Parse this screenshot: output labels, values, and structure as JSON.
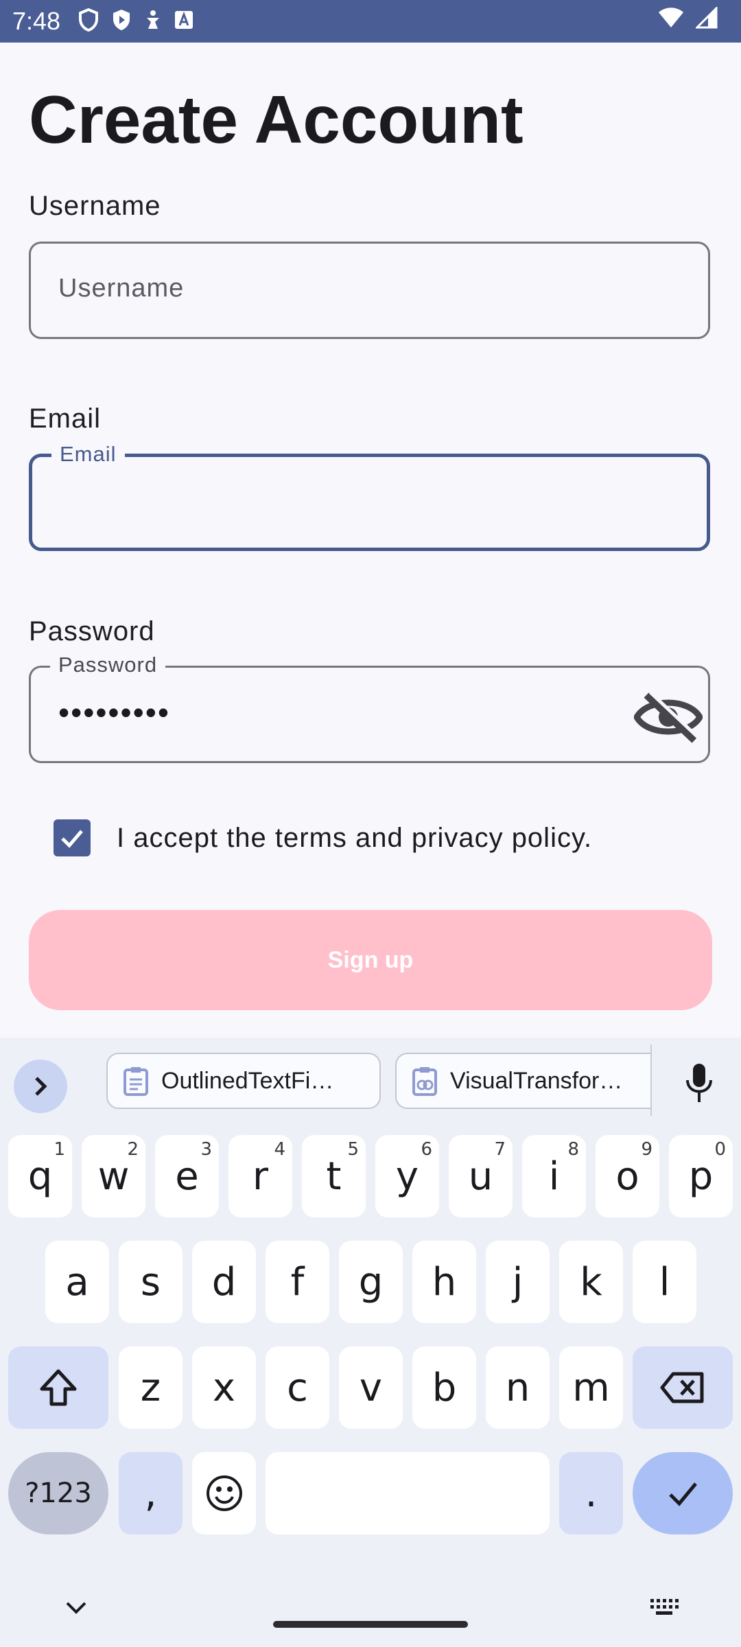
{
  "status_bar": {
    "time": "7:48"
  },
  "page": {
    "title": "Create Account"
  },
  "form": {
    "username": {
      "label": "Username",
      "placeholder": "Username"
    },
    "email": {
      "label": "Email",
      "floating_label": "Email",
      "value": ""
    },
    "password": {
      "label": "Password",
      "floating_label": "Password",
      "masked_value": "•••••••••",
      "toggle_icon": "visibility-off-icon"
    },
    "terms": {
      "checked": true,
      "text": "I accept the terms and privacy policy."
    },
    "signup_button": "Sign up"
  },
  "colors": {
    "primary": "#4a5d94",
    "signup_disabled": "#ffc0cc",
    "focused_border": "#465a8e"
  },
  "keyboard": {
    "suggestions": [
      "OutlinedTextFi…",
      "VisualTransfor…"
    ],
    "row1": [
      {
        "k": "q",
        "h": "1"
      },
      {
        "k": "w",
        "h": "2"
      },
      {
        "k": "e",
        "h": "3"
      },
      {
        "k": "r",
        "h": "4"
      },
      {
        "k": "t",
        "h": "5"
      },
      {
        "k": "y",
        "h": "6"
      },
      {
        "k": "u",
        "h": "7"
      },
      {
        "k": "i",
        "h": "8"
      },
      {
        "k": "o",
        "h": "9"
      },
      {
        "k": "p",
        "h": "0"
      }
    ],
    "row2": [
      "a",
      "s",
      "d",
      "f",
      "g",
      "h",
      "j",
      "k",
      "l"
    ],
    "row3": [
      "z",
      "x",
      "c",
      "v",
      "b",
      "n",
      "m"
    ],
    "symbols_key": "?123",
    "comma_key": ",",
    "period_key": "."
  }
}
